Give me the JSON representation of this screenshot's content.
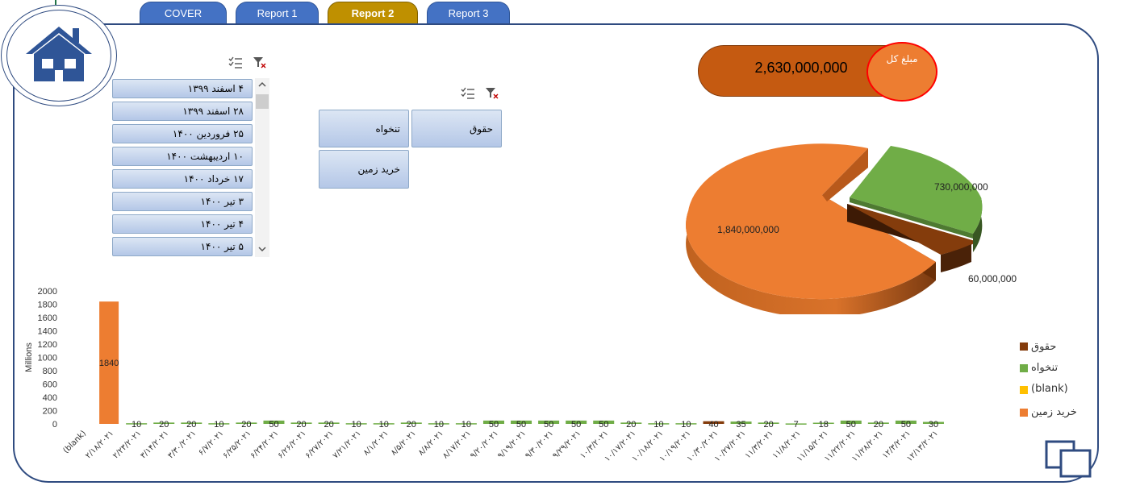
{
  "tabs": [
    {
      "label": "COVER"
    },
    {
      "label": "Report 1"
    },
    {
      "label": "Report 2",
      "active": true
    },
    {
      "label": "Report 3"
    }
  ],
  "date_slicer": {
    "items": [
      "۴ اسفند ۱۳۹۹",
      "۲۸ اسفند ۱۳۹۹",
      "۲۵ فروردین ۱۴۰۰",
      "۱۰ اردیبهشت ۱۴۰۰",
      "۱۷ خرداد ۱۴۰۰",
      "۳ تیر ۱۴۰۰",
      "۴ تیر ۱۴۰۰",
      "۵ تیر ۱۴۰۰"
    ]
  },
  "category_slicer": {
    "items": [
      "حقوق",
      "تنخواه",
      "خرید زمین"
    ]
  },
  "total": {
    "label": "مبلغ کل",
    "value": "2,630,000,000"
  },
  "colors": {
    "accent": "#4472c4",
    "active_tab": "#bf9000",
    "orange": "#ed7d31",
    "green": "#70ad47",
    "brown": "#843c0c",
    "yellow": "#ffc000",
    "frame": "#2f4b80"
  },
  "chart_data": [
    {
      "type": "pie",
      "slices": [
        {
          "name": "خرید زمین",
          "value": 1840000000,
          "label": "1,840,000,000",
          "color": "#ed7d31"
        },
        {
          "name": "تنخواه",
          "value": 730000000,
          "label": "730,000,000",
          "color": "#70ad47"
        },
        {
          "name": "حقوق",
          "value": 60000000,
          "label": "60,000,000",
          "color": "#843c0c"
        }
      ]
    },
    {
      "type": "bar",
      "ylabel": "Millions",
      "ylim": [
        0,
        2000
      ],
      "yticks": [
        0,
        200,
        400,
        600,
        800,
        1000,
        1200,
        1400,
        1600,
        1800,
        2000
      ],
      "legend": [
        {
          "name": "حقوق",
          "color": "#843c0c"
        },
        {
          "name": "تنخواه",
          "color": "#70ad47"
        },
        {
          "name": "(blank)",
          "color": "#ffc000"
        },
        {
          "name": "خرید زمین",
          "color": "#ed7d31"
        }
      ],
      "legend_position": "right",
      "categories": [
        "(blank)",
        "۲/۱۸/۲۰۲۱",
        "۲/۲۳/۲۰۲۱",
        "۳/۱۴/۲۰۲۱",
        "۳/۳۰/۲۰۲۱",
        "۶/۷/۲۰۲۱",
        "۶/۲۵/۲۰۲۱",
        "۶/۲۴/۲۰۲۱",
        "۶/۲۶/۲۰۲۱",
        "۶/۲۷/۲۰۲۱",
        "۷/۲۱/۲۰۲۱",
        "۸/۱/۲۰۲۱",
        "۸/۵/۲۰۲۱",
        "۸/۸/۲۰۲۱",
        "۸/۱۷/۲۰۲۱",
        "۹/۲۰/۲۰۲۱",
        "۹/۱۹/۲۰۲۱",
        "۹/۳۰/۲۰۲۱",
        "۹/۲۹/۲۰۲۱",
        "۱۰/۳/۲۰۲۱",
        "۱۰/۱۷/۲۰۲۱",
        "۱۰/۱۸/۲۰۲۱",
        "۱۰/۱۹/۲۰۲۱",
        "۱۰/۳۰/۲۰۲۱",
        "۱۰/۲۷/۲۰۲۱",
        "۱۱/۳/۲۰۲۱",
        "۱۱/۸/۲۰۲۱",
        "۱۱/۱۵/۲۰۲۱",
        "۱۱/۲۲/۲۰۲۱",
        "۱۱/۲۸/۲۰۲۱",
        "۱۲/۳/۲۰۲۱",
        "۱۲/۱۳/۲۰۲۱"
      ],
      "bars": [
        {
          "value": null,
          "label": "",
          "series": ""
        },
        {
          "value": 1840,
          "label": "1840",
          "series": "خرید زمین"
        },
        {
          "value": 10,
          "label": "10",
          "series": "تنخواه"
        },
        {
          "value": 20,
          "label": "20",
          "series": "تنخواه"
        },
        {
          "value": 20,
          "label": "20",
          "series": "تنخواه"
        },
        {
          "value": 10,
          "label": "10",
          "series": "تنخواه"
        },
        {
          "value": 20,
          "label": "20",
          "series": "تنخواه"
        },
        {
          "value": 50,
          "label": "50",
          "series": "تنخواه"
        },
        {
          "value": 20,
          "label": "20",
          "series": "تنخواه"
        },
        {
          "value": 20,
          "label": "20",
          "series": "تنخواه"
        },
        {
          "value": 10,
          "label": "10",
          "series": "تنخواه"
        },
        {
          "value": 10,
          "label": "10",
          "series": "تنخواه"
        },
        {
          "value": 20,
          "label": "20",
          "series": "تنخواه"
        },
        {
          "value": 10,
          "label": "10",
          "series": "تنخواه"
        },
        {
          "value": 10,
          "label": "10",
          "series": "تنخواه"
        },
        {
          "value": 50,
          "label": "50",
          "series": "تنخواه"
        },
        {
          "value": 50,
          "label": "50",
          "series": "تنخواه"
        },
        {
          "value": 50,
          "label": "50",
          "series": "تنخواه"
        },
        {
          "value": 50,
          "label": "50",
          "series": "تنخواه"
        },
        {
          "value": 50,
          "label": "50",
          "series": "تنخواه"
        },
        {
          "value": 20,
          "label": "20",
          "series": "تنخواه"
        },
        {
          "value": 10,
          "label": "10",
          "series": "تنخواه"
        },
        {
          "value": 10,
          "label": "10",
          "series": "تنخواه"
        },
        {
          "value": 40,
          "label": "40",
          "series": "حقوق"
        },
        {
          "value": 35,
          "label": "35",
          "series": "تنخواه"
        },
        {
          "value": 20,
          "label": "20",
          "series": "تنخواه"
        },
        {
          "value": 7,
          "label": "7",
          "series": "تنخواه"
        },
        {
          "value": 18,
          "label": "18",
          "series": "تنخواه"
        },
        {
          "value": 50,
          "label": "50",
          "series": "تنخواه"
        },
        {
          "value": 20,
          "label": "20",
          "series": "تنخواه"
        },
        {
          "value": 50,
          "label": "50",
          "series": "تنخواه"
        },
        {
          "value": 30,
          "label": "30",
          "series": "تنخواه"
        }
      ]
    }
  ]
}
